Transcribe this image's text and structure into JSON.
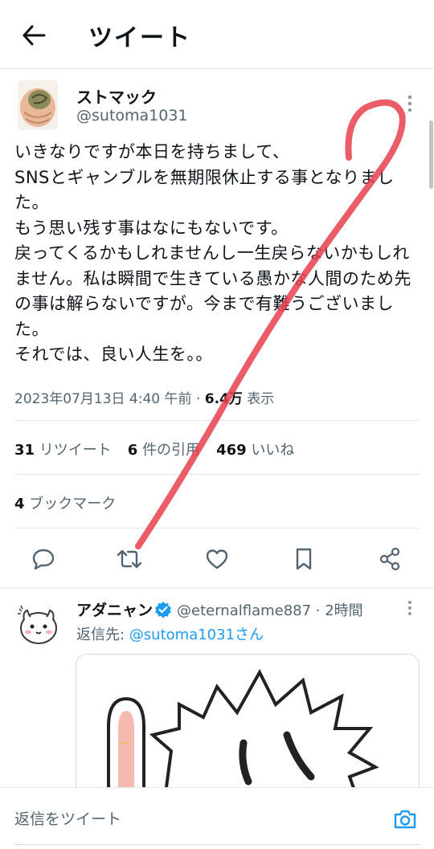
{
  "header": {
    "back_icon": "arrow-left-icon",
    "title": "ツイート"
  },
  "tweet": {
    "author_name": "ストマック",
    "author_handle": "@sutoma1031",
    "body": "いきなりですが本日を持ちまして、\nSNSとギャンブルを無期限休止する事となりました。\nもう思い残す事はなにもないです。\n戻ってくるかもしれませんし一生戻らないかもしれません。私は瞬間で生きている愚かな人間のため先の事は解らないですが。今まで有難うございました。\nそれでは、良い人生を。。",
    "timestamp": "2023年07月13日 4:40 午前",
    "views_count": "6.4万",
    "views_label": "表示",
    "retweets_count": "31",
    "retweets_label": "リツイート",
    "quotes_count": "6",
    "quotes_label": "件の引用",
    "likes_count": "469",
    "likes_label": "いいね",
    "bookmarks_count": "4",
    "bookmarks_label": "ブックマーク"
  },
  "actions": [
    "reply-icon",
    "retweet-icon",
    "like-icon",
    "bookmark-icon",
    "share-icon"
  ],
  "reply": {
    "author_name": "アダニャン",
    "handle_and_time": "@eternalflame887 · 2時間",
    "reply_to_prefix": "返信先: ",
    "reply_to_handle": "@sutoma1031さん"
  },
  "reply_bar": {
    "placeholder": "返信をツイート",
    "camera_icon": "camera-icon"
  },
  "colors": {
    "accent": "#1d9bf0",
    "text": "#0f1419",
    "secondary": "#536471",
    "annotation": "#e8404f"
  }
}
